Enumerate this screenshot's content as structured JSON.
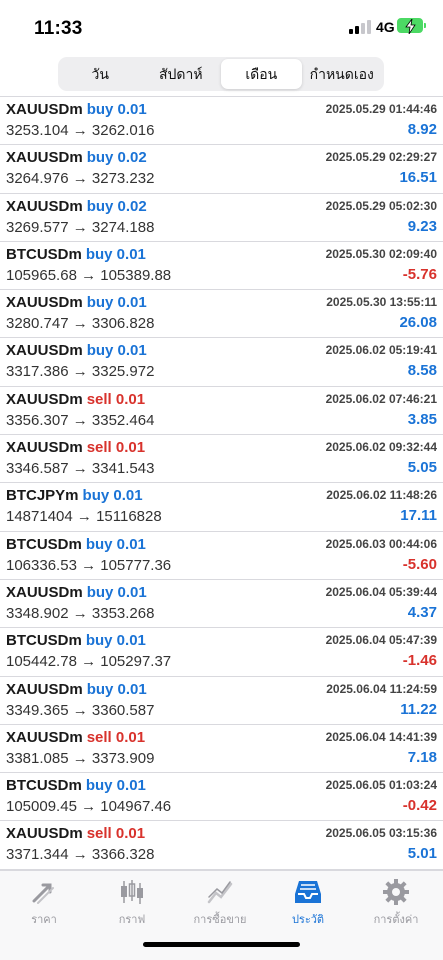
{
  "status": {
    "time": "11:33",
    "network": "4G",
    "battery": "charging"
  },
  "segments": [
    {
      "label": "วัน",
      "active": false
    },
    {
      "label": "สัปดาห์",
      "active": false
    },
    {
      "label": "เดือน",
      "active": true
    },
    {
      "label": "กำหนดเอง",
      "active": false
    }
  ],
  "trades": [
    {
      "symbol": "XAUUSDm",
      "direction": "buy 0.01",
      "type": "buy",
      "prices": "3253.104 → 3262.016",
      "datetime": "2025.05.29 01:44:46",
      "profit": "8.92"
    },
    {
      "symbol": "XAUUSDm",
      "direction": "buy 0.02",
      "type": "buy",
      "prices": "3264.976 → 3273.232",
      "datetime": "2025.05.29 02:29:27",
      "profit": "16.51"
    },
    {
      "symbol": "XAUUSDm",
      "direction": "buy 0.02",
      "type": "buy",
      "prices": "3269.577 → 3274.188",
      "datetime": "2025.05.29 05:02:30",
      "profit": "9.23"
    },
    {
      "symbol": "BTCUSDm",
      "direction": "buy 0.01",
      "type": "buy",
      "prices": "105965.68 → 105389.88",
      "datetime": "2025.05.30 02:09:40",
      "profit": "-5.76"
    },
    {
      "symbol": "XAUUSDm",
      "direction": "buy 0.01",
      "type": "buy",
      "prices": "3280.747 → 3306.828",
      "datetime": "2025.05.30 13:55:11",
      "profit": "26.08"
    },
    {
      "symbol": "XAUUSDm",
      "direction": "buy 0.01",
      "type": "buy",
      "prices": "3317.386 → 3325.972",
      "datetime": "2025.06.02 05:19:41",
      "profit": "8.58"
    },
    {
      "symbol": "XAUUSDm",
      "direction": "sell 0.01",
      "type": "sell",
      "prices": "3356.307 → 3352.464",
      "datetime": "2025.06.02 07:46:21",
      "profit": "3.85"
    },
    {
      "symbol": "XAUUSDm",
      "direction": "sell 0.01",
      "type": "sell",
      "prices": "3346.587 → 3341.543",
      "datetime": "2025.06.02 09:32:44",
      "profit": "5.05"
    },
    {
      "symbol": "BTCJPYm",
      "direction": "buy 0.01",
      "type": "buy",
      "prices": "14871404 → 15116828",
      "datetime": "2025.06.02 11:48:26",
      "profit": "17.11"
    },
    {
      "symbol": "BTCUSDm",
      "direction": "buy 0.01",
      "type": "buy",
      "prices": "106336.53 → 105777.36",
      "datetime": "2025.06.03 00:44:06",
      "profit": "-5.60"
    },
    {
      "symbol": "XAUUSDm",
      "direction": "buy 0.01",
      "type": "buy",
      "prices": "3348.902 → 3353.268",
      "datetime": "2025.06.04 05:39:44",
      "profit": "4.37"
    },
    {
      "symbol": "BTCUSDm",
      "direction": "buy 0.01",
      "type": "buy",
      "prices": "105442.78 → 105297.37",
      "datetime": "2025.06.04 05:47:39",
      "profit": "-1.46"
    },
    {
      "symbol": "XAUUSDm",
      "direction": "buy 0.01",
      "type": "buy",
      "prices": "3349.365 → 3360.587",
      "datetime": "2025.06.04 11:24:59",
      "profit": "11.22"
    },
    {
      "symbol": "XAUUSDm",
      "direction": "sell 0.01",
      "type": "sell",
      "prices": "3381.085 → 3373.909",
      "datetime": "2025.06.04 14:41:39",
      "profit": "7.18"
    },
    {
      "symbol": "BTCUSDm",
      "direction": "buy 0.01",
      "type": "buy",
      "prices": "105009.45 → 104967.46",
      "datetime": "2025.06.05 01:03:24",
      "profit": "-0.42"
    },
    {
      "symbol": "XAUUSDm",
      "direction": "sell 0.01",
      "type": "sell",
      "prices": "3371.344 → 3366.328",
      "datetime": "2025.06.05 03:15:36",
      "profit": "5.01"
    }
  ],
  "tabs": [
    {
      "label": "ราคา",
      "icon": "price-arrows-icon",
      "active": false
    },
    {
      "label": "กราฟ",
      "icon": "candlestick-chart-icon",
      "active": false
    },
    {
      "label": "การซื้อขาย",
      "icon": "trade-line-icon",
      "active": false
    },
    {
      "label": "ประวัติ",
      "icon": "history-inbox-icon",
      "active": true
    },
    {
      "label": "การตั้งค่า",
      "icon": "gear-icon",
      "active": false
    }
  ],
  "colors": {
    "accent": "#1a73d6",
    "negative": "#d8322c",
    "inactive": "#9a9aa0",
    "battery": "#4cd964"
  }
}
